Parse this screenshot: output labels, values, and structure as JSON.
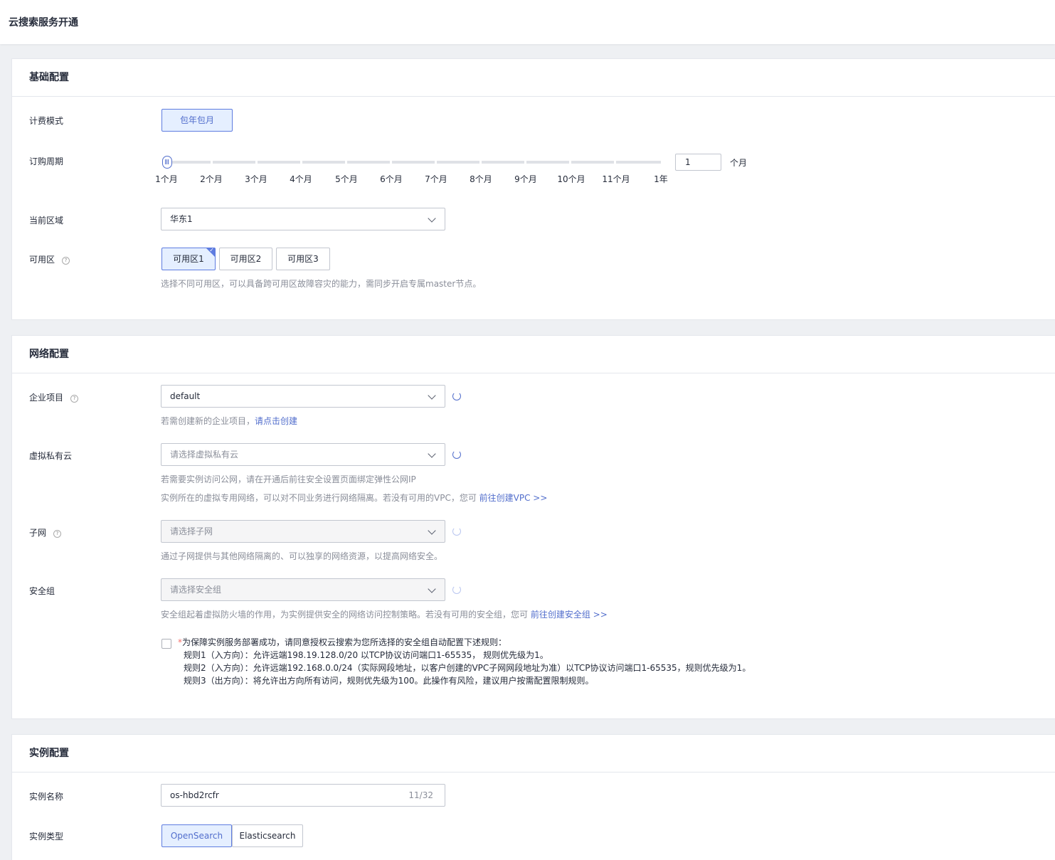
{
  "page": {
    "title": "云搜索服务开通"
  },
  "basic": {
    "section_title": "基础配置",
    "billing_label": "计费模式",
    "billing_option": "包年包月",
    "period_label": "订购周期",
    "period_ticks": [
      "1个月",
      "2个月",
      "3个月",
      "4个月",
      "5个月",
      "6个月",
      "7个月",
      "8个月",
      "9个月",
      "10个月",
      "11个月",
      "1年"
    ],
    "period_value": "1",
    "period_unit": "个月",
    "region_label": "当前区域",
    "region_value": "华东1",
    "az_label": "可用区",
    "az_options": [
      "可用区1",
      "可用区2",
      "可用区3"
    ],
    "az_selected": "可用区1",
    "az_hint": "选择不同可用区，可以具备跨可用区故障容灾的能力，需同步开启专属master节点。"
  },
  "network": {
    "section_title": "网络配置",
    "ep_label": "企业项目",
    "ep_value": "default",
    "ep_hint": "若需创建新的企业项目，",
    "ep_link": "请点击创建",
    "vpc_label": "虚拟私有云",
    "vpc_placeholder": "请选择虚拟私有云",
    "vpc_hint1": "若需要实例访问公网，请在开通后前往安全设置页面绑定弹性公网IP",
    "vpc_hint2": "实例所在的虚拟专用网络，可以对不同业务进行网络隔离。若没有可用的VPC，您可",
    "vpc_link": "前往创建VPC >>",
    "subnet_label": "子网",
    "subnet_placeholder": "请选择子网",
    "subnet_hint": "通过子网提供与其他网络隔离的、可以独享的网络资源，以提高网络安全。",
    "sg_label": "安全组",
    "sg_placeholder": "请选择安全组",
    "sg_hint": "安全组起着虚拟防火墙的作用，为实例提供安全的网络访问控制策略。若没有可用的安全组，您可",
    "sg_link": "前往创建安全组 >>",
    "agree_req": "*",
    "agree_text": "为保障实例服务部署成功，请同意授权云搜索为您所选择的安全组自动配置下述规则：",
    "rules": [
      "规则1（入方向）：允许远端198.19.128.0/20 以TCP协议访问端口1-65535， 规则优先级为1。",
      "规则2（入方向）：允许远端192.168.0.0/24（实际网段地址，以客户创建的VPC子网网段地址为准）以TCP协议访问端口1-65535，规则优先级为1。",
      "规则3（出方向）：将允许出方向所有访问，规则优先级为100。此操作有风险，建议用户按需配置限制规则。"
    ]
  },
  "instance": {
    "section_title": "实例配置",
    "name_label": "实例名称",
    "name_value": "os-hbd2rcfr",
    "name_count": "11/32",
    "type_label": "实例类型",
    "type_options": [
      "OpenSearch",
      "Elasticsearch"
    ],
    "type_selected": "OpenSearch"
  },
  "colors": {
    "accent": "#526ecc",
    "accent_bg": "#e5efff",
    "border": "#c2c6cf",
    "hint": "#8a8e99"
  }
}
